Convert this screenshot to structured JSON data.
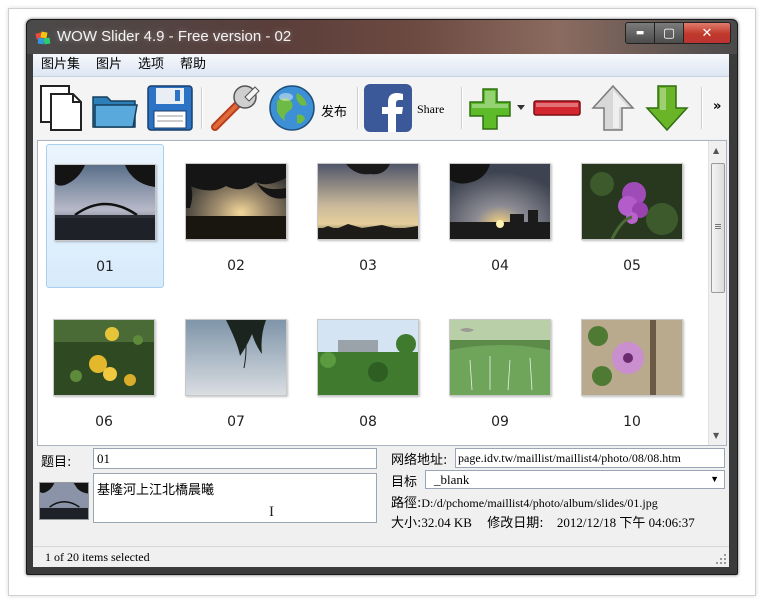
{
  "window": {
    "title": "WOW Slider 4.9 - Free version - 02",
    "minimize": "▬",
    "maximize": "▢",
    "close": "✕"
  },
  "menu": {
    "items": [
      "图片集",
      "图片",
      "选项",
      "帮助"
    ]
  },
  "toolbar": {
    "publish_label": "发布",
    "share_label": "Share",
    "overflow": "»",
    "icons": {
      "new": "new-document-icon",
      "open": "open-folder-icon",
      "save": "floppy-disk-icon",
      "settings": "wrench-icon",
      "publish": "globe-icon",
      "share": "facebook-icon",
      "add": "plus-icon",
      "remove": "minus-icon",
      "up": "arrow-up-icon",
      "down": "arrow-down-icon"
    },
    "colors": {
      "add": "#5dbb2a",
      "remove": "#d3262e",
      "down": "#6ab527",
      "facebook": "#3b5998"
    }
  },
  "gallery": {
    "thumbs": [
      {
        "caption": "01",
        "selected": true
      },
      {
        "caption": "02",
        "selected": false
      },
      {
        "caption": "03",
        "selected": false
      },
      {
        "caption": "04",
        "selected": false
      },
      {
        "caption": "05",
        "selected": false
      },
      {
        "caption": "06",
        "selected": false
      },
      {
        "caption": "07",
        "selected": false
      },
      {
        "caption": "08",
        "selected": false
      },
      {
        "caption": "09",
        "selected": false
      },
      {
        "caption": "10",
        "selected": false
      }
    ]
  },
  "properties": {
    "title_label": "题目:",
    "title_value": "01",
    "description_value": "基隆河上江北橋晨曦",
    "url_label": "网络地址:",
    "url_value": "page.idv.tw/maillist/maillist4/photo/08/08.htm",
    "target_label": "目标",
    "target_value": "_blank",
    "path_label": "路徑:",
    "path_value": "D:/d/pchome/maillist4/photo/album/slides/01.jpg",
    "size_label": "大小:",
    "size_value": "32.04 KB",
    "modified_label": "修改日期:",
    "modified_value": "2012/12/18 下午 04:06:37"
  },
  "status": {
    "text": "1 of 20 items selected"
  }
}
